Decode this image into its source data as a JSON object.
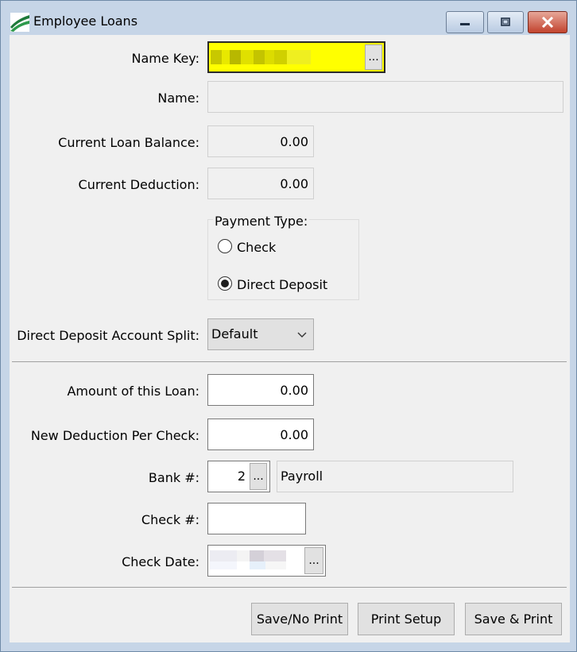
{
  "window": {
    "title": "Employee Loans"
  },
  "titlebar_buttons": {
    "minimize": "minimize-icon",
    "maximize": "maximize-icon",
    "close": "close-icon"
  },
  "colors": {
    "highlight": "#ffff00",
    "frame": "#c6d5e7",
    "client": "#f0f0f0"
  },
  "form": {
    "name_key": {
      "label": "Name Key:",
      "browse": "..."
    },
    "name": {
      "label": "Name:",
      "value": ""
    },
    "current_loan_balance": {
      "label": "Current Loan Balance:",
      "value": "0.00"
    },
    "current_deduction": {
      "label": "Current Deduction:",
      "value": "0.00"
    },
    "payment_type": {
      "label": "Payment Type:",
      "options": [
        "Check",
        "Direct Deposit"
      ],
      "selected": "Direct Deposit"
    },
    "dd_split": {
      "label": "Direct Deposit Account Split:",
      "value": "Default"
    },
    "amount_of_loan": {
      "label": "Amount of this Loan:",
      "value": "0.00"
    },
    "new_deduction": {
      "label": "New Deduction Per Check:",
      "value": "0.00"
    },
    "bank": {
      "label": "Bank #:",
      "value": "2",
      "browse": "...",
      "name": "Payroll"
    },
    "check_no": {
      "label": "Check #:",
      "value": ""
    },
    "check_date": {
      "label": "Check Date:",
      "browse": "..."
    }
  },
  "buttons": {
    "save_no_print": "Save/No Print",
    "print_setup": "Print Setup",
    "save_print": "Save & Print"
  }
}
